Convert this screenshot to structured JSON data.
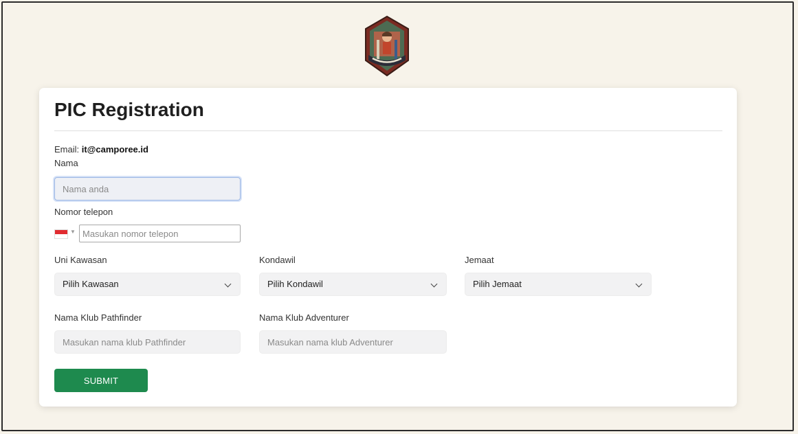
{
  "header": {
    "logo_name": "niscada-badge-logo"
  },
  "form": {
    "title": "PIC Registration",
    "email_label": "Email:",
    "email_value": "it@camporee.id",
    "name": {
      "label": "Nama",
      "placeholder": "Nama anda"
    },
    "phone": {
      "label": "Nomor telepon",
      "placeholder": "Masukan nomor telepon",
      "country_flag": "indonesia-flag-icon"
    },
    "uni_kawasan": {
      "label": "Uni Kawasan",
      "selected": "Pilih Kawasan"
    },
    "kondawil": {
      "label": "Kondawil",
      "selected": "Pilih Kondawil"
    },
    "jemaat": {
      "label": "Jemaat",
      "selected": "Pilih Jemaat"
    },
    "pathfinder": {
      "label": "Nama Klub Pathfinder",
      "placeholder": "Masukan nama klub Pathfinder"
    },
    "adventurer": {
      "label": "Nama Klub Adventurer",
      "placeholder": "Masukan nama klub Adventurer"
    },
    "submit_label": "SUBMIT"
  },
  "colors": {
    "page_bg": "#f7f3ea",
    "card_bg": "#ffffff",
    "submit_bg": "#1e8a4e",
    "focus_border": "#9bb6e4"
  }
}
